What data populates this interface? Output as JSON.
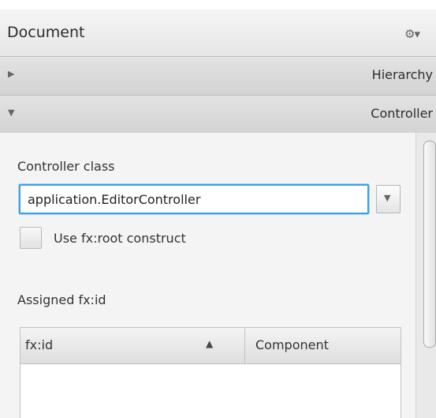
{
  "document_header": {
    "title": "Document",
    "gear_glyph": "⚙▾"
  },
  "sections": [
    {
      "label": "Hierarchy",
      "expanded": false,
      "arrow": "▶"
    },
    {
      "label": "Controller",
      "expanded": true,
      "arrow": "▼"
    }
  ],
  "controller": {
    "class_label": "Controller class",
    "class_value": "application.EditorController",
    "dropdown_caret": "▼",
    "use_root_label": "Use fx:root construct",
    "use_root_checked": false,
    "assigned_label": "Assigned fx:id"
  },
  "table": {
    "columns": [
      {
        "label": "fx:id",
        "sort": "ascending",
        "sort_glyph": "▲"
      },
      {
        "label": "Component"
      }
    ],
    "rows": []
  },
  "icons": {
    "gear": "gear-icon",
    "collapsed_arrow": "triangle-right-icon",
    "expanded_arrow": "triangle-down-icon"
  },
  "colors": {
    "focus_border": "#3aa0e8",
    "title_bar": "#d9d9d9",
    "content_bg": "#f4f4f4"
  }
}
